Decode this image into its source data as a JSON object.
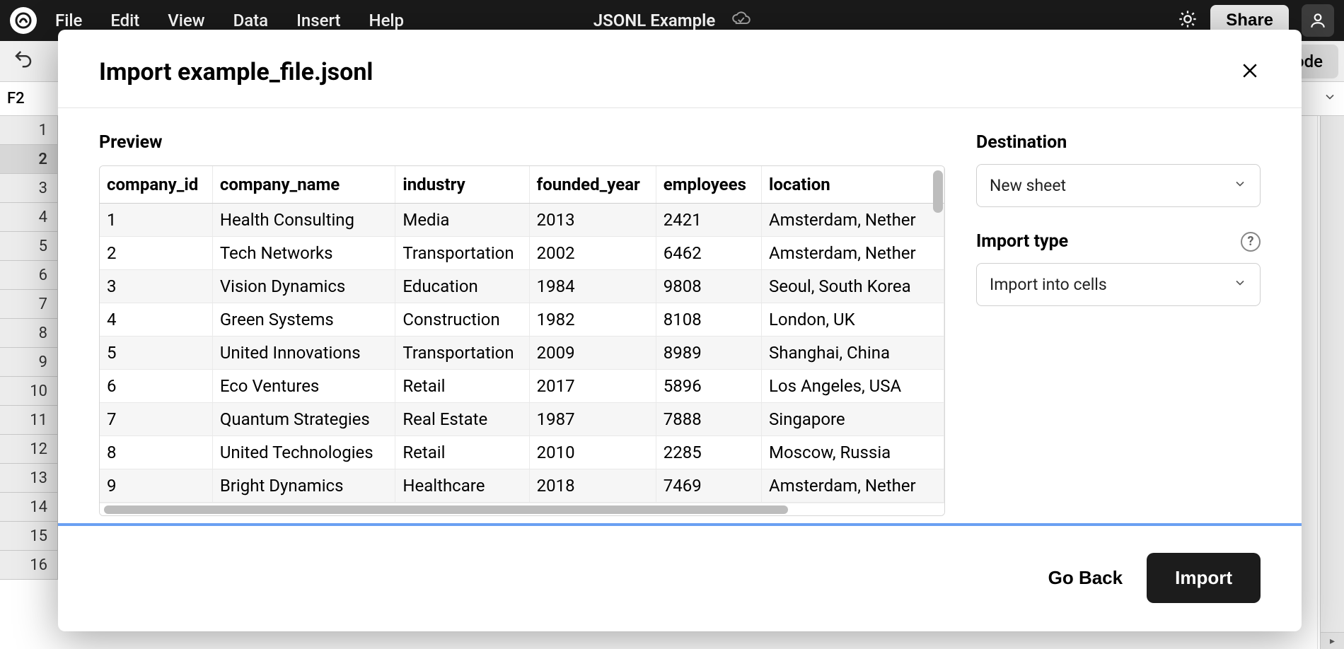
{
  "menubar": {
    "items": [
      "File",
      "Edit",
      "View",
      "Data",
      "Insert",
      "Help"
    ],
    "title": "JSONL Example",
    "share": "Share"
  },
  "toolbar": {
    "code": "Code"
  },
  "formula": {
    "cell_ref": "F2"
  },
  "sheet": {
    "row_numbers": [
      "1",
      "2",
      "3",
      "4",
      "5",
      "6",
      "7",
      "8",
      "9",
      "10",
      "11",
      "12",
      "13",
      "14",
      "15",
      "16"
    ],
    "selected_row_index": 1
  },
  "dialog": {
    "title": "Import example_file.jsonl",
    "preview_label": "Preview",
    "destination_label": "Destination",
    "destination_value": "New sheet",
    "import_type_label": "Import type",
    "import_type_value": "Import into cells",
    "go_back": "Go Back",
    "import": "Import",
    "columns": [
      "company_id",
      "company_name",
      "industry",
      "founded_year",
      "employees",
      "location"
    ],
    "rows": [
      [
        "1",
        "Health Consulting",
        "Media",
        "2013",
        "2421",
        "Amsterdam, Nether"
      ],
      [
        "2",
        "Tech Networks",
        "Transportation",
        "2002",
        "6462",
        "Amsterdam, Nether"
      ],
      [
        "3",
        "Vision Dynamics",
        "Education",
        "1984",
        "9808",
        "Seoul, South Korea"
      ],
      [
        "4",
        "Green Systems",
        "Construction",
        "1982",
        "8108",
        "London, UK"
      ],
      [
        "5",
        "United Innovations",
        "Transportation",
        "2009",
        "8989",
        "Shanghai, China"
      ],
      [
        "6",
        "Eco Ventures",
        "Retail",
        "2017",
        "5896",
        "Los Angeles, USA"
      ],
      [
        "7",
        "Quantum Strategies",
        "Real Estate",
        "1987",
        "7888",
        "Singapore"
      ],
      [
        "8",
        "United Technologies",
        "Retail",
        "2010",
        "2285",
        "Moscow, Russia"
      ],
      [
        "9",
        "Bright Dynamics",
        "Healthcare",
        "2018",
        "7469",
        "Amsterdam, Nether"
      ]
    ]
  }
}
